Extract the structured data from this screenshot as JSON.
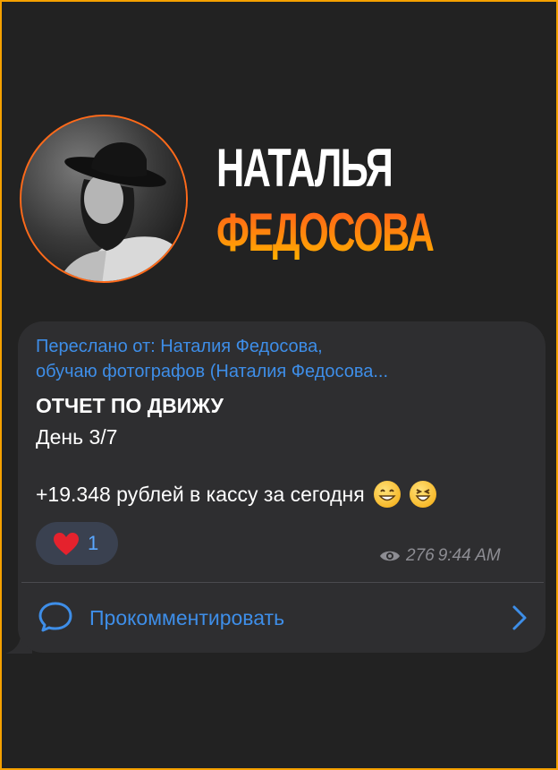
{
  "header": {
    "first_name": "НАТАЛЬЯ",
    "last_name": "ФЕДОСОВА"
  },
  "message": {
    "forwarded_line1": "Переслано от: Наталия Федосова,",
    "forwarded_line2": "обучаю фотографов (Наталия Федосова...",
    "title": "ОТЧЕТ ПО ДВИЖУ",
    "day": "День 3/7",
    "summary": "+19.348 рублей в кассу за сегодня",
    "reaction_count": "1",
    "views": "276",
    "time": "9:44 AM",
    "comment_label": "Прокомментировать"
  },
  "colors": {
    "frame_border": "#f5a100",
    "accent_orange": "#ff8a00",
    "link_blue": "#3e8ee8",
    "bubble_bg": "#2e2e30",
    "background": "#222222"
  },
  "icons": {
    "reaction": "heart-icon",
    "views": "eye-icon",
    "comment": "comment-bubble-icon",
    "open": "chevron-right-icon",
    "emoji1": "grinning-face-emoji",
    "emoji2": "laughing-face-emoji"
  }
}
